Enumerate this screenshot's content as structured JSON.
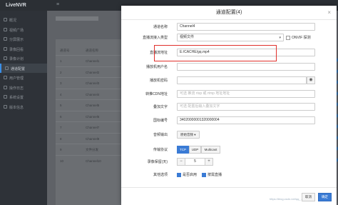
{
  "app": {
    "name": "LiveNVR",
    "menu_icon": "menu-icon"
  },
  "sidebar": {
    "items": [
      {
        "label": "概况",
        "icon": "home-icon"
      },
      {
        "label": "视频广场",
        "icon": "grid-icon"
      },
      {
        "label": "分屏展示",
        "icon": "split-icon"
      },
      {
        "label": "录像回看",
        "icon": "record-icon"
      },
      {
        "label": "录像计划",
        "icon": "calendar-icon"
      },
      {
        "label": "通道配置",
        "icon": "settings-icon"
      },
      {
        "label": "用户管理",
        "icon": "user-icon"
      },
      {
        "label": "操作日志",
        "icon": "log-icon"
      },
      {
        "label": "系统设置",
        "icon": "gear-icon"
      },
      {
        "label": "版本信息",
        "icon": "info-icon"
      }
    ],
    "active_index": 5
  },
  "background_table": {
    "headers": [
      "通道号",
      "通道名称"
    ],
    "rows": [
      {
        "no": "1",
        "name": "Channel1"
      },
      {
        "no": "2",
        "name": "Channel2"
      },
      {
        "no": "3",
        "name": "Channel3"
      },
      {
        "no": "4",
        "name": "Channel4"
      },
      {
        "no": "5",
        "name": "Channel5"
      },
      {
        "no": "6",
        "name": "Channel6"
      },
      {
        "no": "7",
        "name": "Channel7"
      },
      {
        "no": "8",
        "name": "Channel8"
      },
      {
        "no": "9",
        "name": "文件分发"
      },
      {
        "no": "10",
        "name": "Channel10"
      }
    ]
  },
  "modal": {
    "title": "通道配置(4)",
    "close_icon": "close-icon",
    "fields": {
      "channel_name": {
        "label": "通道名称",
        "value": "Channel4"
      },
      "access_type": {
        "label": "直播流接入类型",
        "value": "视频文件",
        "onvif_label": "ONVIF 探测"
      },
      "stream_url": {
        "label": "直播流地址",
        "value": "E:/CACHE/gq.mp4"
      },
      "username": {
        "label": "播放机用户名",
        "value": ""
      },
      "password": {
        "label": "播放机密码",
        "value": ""
      },
      "cdn_url": {
        "label": "转推CDN地址",
        "placeholder": "可选 推流 rtsp 或 rtmp 地址地址"
      },
      "overlay_text": {
        "label": "叠加文字",
        "placeholder": "可选 配置后输入叠加文字"
      },
      "gb_code": {
        "label": "国标编号",
        "value": "34020000001320000004"
      },
      "audio": {
        "label": "音频输出",
        "value": "原始音频"
      },
      "transport": {
        "label": "传输协议",
        "options": [
          "TCP",
          "UDP",
          "Multicast"
        ],
        "selected": "TCP"
      },
      "retention_days": {
        "label": "录像保留(天)",
        "value": "5"
      },
      "others": {
        "label": "其他选项",
        "enable_label": "是否启用",
        "record_label": "按需直播"
      }
    },
    "footer": {
      "cancel_label": "取消",
      "ok_label": "确定"
    }
  },
  "watermark": "https://blog.csdn.net/qq_..."
}
